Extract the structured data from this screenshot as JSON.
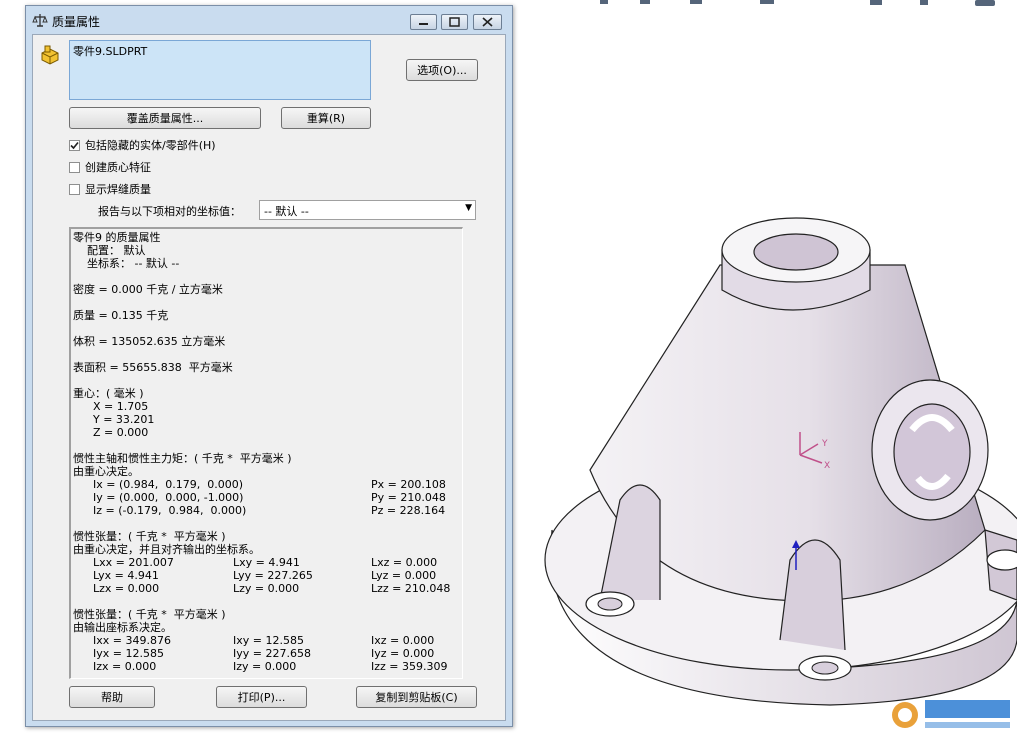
{
  "window": {
    "title": "质量属性"
  },
  "selection": {
    "item": "零件9.SLDPRT"
  },
  "buttons": {
    "options": "选项(O)...",
    "override": "覆盖质量属性...",
    "recalculate": "重算(R)",
    "help": "帮助",
    "print": "打印(P)...",
    "copy": "复制到剪贴板(C)"
  },
  "checkboxes": [
    {
      "label": "包括隐藏的实体/零部件(H)",
      "checked": true
    },
    {
      "label": "创建质心特征",
      "checked": false
    },
    {
      "label": "显示焊缝质量",
      "checked": false
    }
  ],
  "coord": {
    "label": "报告与以下项相对的坐标值：",
    "value": "-- 默认 --"
  },
  "results": {
    "header": "零件9 的质量属性",
    "config": "配置： 默认",
    "coord_system": "坐标系： -- 默认 --",
    "density": "密度 = 0.000 千克 / 立方毫米",
    "mass": "质量 = 0.135 千克",
    "volume": "体积 = 135052.635 立方毫米",
    "surface_area": "表面积 = 55655.838  平方毫米",
    "com_title": "重心：( 毫米 )",
    "com_x": "X = 1.705",
    "com_y": "Y = 33.201",
    "com_z": "Z = 0.000",
    "principal_title": "惯性主轴和惯性主力矩：( 千克 *  平方毫米 )",
    "principal_sub": "由重心决定。",
    "ix": "Ix = (0.984,  0.179,  0.000)",
    "iy": "Iy = (0.000,  0.000, -1.000)",
    "iz": "Iz = (-0.179,  0.984,  0.000)",
    "px": "Px = 200.108",
    "py": "Py = 210.048",
    "pz": "Pz = 228.164",
    "tensor1_title": "惯性张量：( 千克 *  平方毫米 )",
    "tensor1_sub": "由重心决定，并且对齐输出的坐标系。",
    "tensor1": [
      [
        "Lxx = 201.007",
        "Lxy = 4.941",
        "Lxz = 0.000"
      ],
      [
        "Lyx = 4.941",
        "Lyy = 227.265",
        "Lyz = 0.000"
      ],
      [
        "Lzx = 0.000",
        "Lzy = 0.000",
        "Lzz = 210.048"
      ]
    ],
    "tensor2_title": "惯性张量：( 千克 *  平方毫米 )",
    "tensor2_sub": "由输出座标系决定。",
    "tensor2": [
      [
        "Ixx = 349.876",
        "Ixy = 12.585",
        "Ixz = 0.000"
      ],
      [
        "Iyx = 12.585",
        "Iyy = 227.658",
        "Iyz = 0.000"
      ],
      [
        "Izx = 0.000",
        "Izy = 0.000",
        "Izz = 359.309"
      ]
    ]
  },
  "viewport": {
    "triad_y": "Y",
    "triad_x": "X"
  },
  "colors": {
    "titlebar": "#c9dcef",
    "selection": "#cce4f7",
    "model": "#d8d0dc",
    "triad": "#c0508a"
  }
}
